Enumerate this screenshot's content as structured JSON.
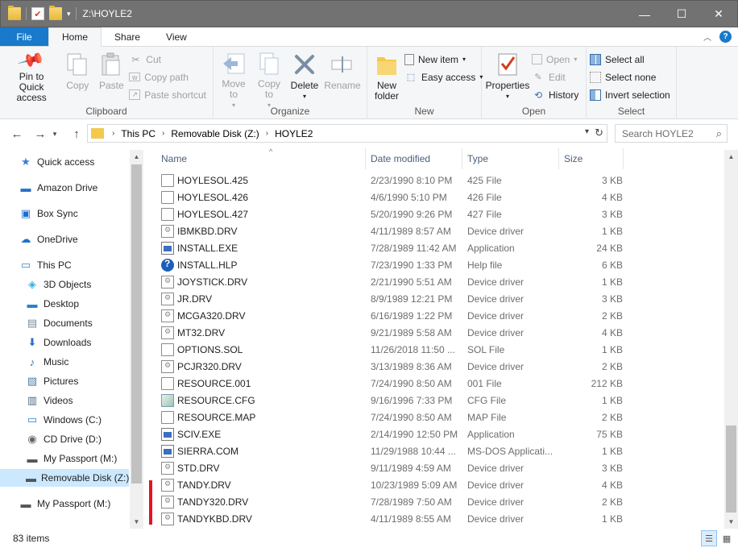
{
  "window": {
    "title": "Z:\\HOYLE2"
  },
  "ribbon_tabs": [
    "File",
    "Home",
    "Share",
    "View"
  ],
  "ribbon": {
    "clipboard": {
      "label": "Clipboard",
      "pin": "Pin to Quick access",
      "copy": "Copy",
      "paste": "Paste",
      "cut": "Cut",
      "copy_path": "Copy path",
      "paste_shortcut": "Paste shortcut"
    },
    "organize": {
      "label": "Organize",
      "move_to": "Move to",
      "copy_to": "Copy to",
      "delete": "Delete",
      "rename": "Rename"
    },
    "new": {
      "label": "New",
      "new_folder": "New folder",
      "new_item": "New item",
      "easy_access": "Easy access"
    },
    "open": {
      "label": "Open",
      "properties": "Properties",
      "open": "Open",
      "edit": "Edit",
      "history": "History"
    },
    "select": {
      "label": "Select",
      "select_all": "Select all",
      "select_none": "Select none",
      "invert": "Invert selection"
    }
  },
  "address": {
    "crumbs": [
      "This PC",
      "Removable Disk (Z:)",
      "HOYLE2"
    ],
    "search_placeholder": "Search HOYLE2"
  },
  "nav": [
    {
      "label": "Quick access",
      "icon": "star-icon"
    },
    {
      "label": "Amazon Drive",
      "icon": "amazon-drive-icon"
    },
    {
      "label": "Box Sync",
      "icon": "box-icon"
    },
    {
      "label": "OneDrive",
      "icon": "cloud-icon"
    },
    {
      "label": "This PC",
      "icon": "computer-icon"
    },
    {
      "label": "3D Objects",
      "icon": "cube-icon"
    },
    {
      "label": "Desktop",
      "icon": "desktop-icon"
    },
    {
      "label": "Documents",
      "icon": "documents-icon"
    },
    {
      "label": "Downloads",
      "icon": "download-arrow-icon"
    },
    {
      "label": "Music",
      "icon": "music-note-icon"
    },
    {
      "label": "Pictures",
      "icon": "pictures-icon"
    },
    {
      "label": "Videos",
      "icon": "film-icon"
    },
    {
      "label": "Windows (C:)",
      "icon": "windows-drive-icon"
    },
    {
      "label": "CD Drive (D:)",
      "icon": "cd-drive-icon"
    },
    {
      "label": "My Passport (M:)",
      "icon": "usb-drive-icon"
    },
    {
      "label": "Removable Disk (Z:)",
      "icon": "usb-drive-icon"
    },
    {
      "label": "My Passport (M:)",
      "icon": "usb-drive-icon"
    }
  ],
  "columns": {
    "name": "Name",
    "date": "Date modified",
    "type": "Type",
    "size": "Size"
  },
  "files": [
    {
      "name": "HOYLESOL.425",
      "date": "2/23/1990 8:10 PM",
      "type": "425 File",
      "size": "3 KB",
      "icon": "doc"
    },
    {
      "name": "HOYLESOL.426",
      "date": "4/6/1990 5:10 PM",
      "type": "426 File",
      "size": "4 KB",
      "icon": "doc"
    },
    {
      "name": "HOYLESOL.427",
      "date": "5/20/1990 9:26 PM",
      "type": "427 File",
      "size": "3 KB",
      "icon": "doc"
    },
    {
      "name": "IBMKBD.DRV",
      "date": "4/11/1989 8:57 AM",
      "type": "Device driver",
      "size": "1 KB",
      "icon": "gear"
    },
    {
      "name": "INSTALL.EXE",
      "date": "7/28/1989 11:42 AM",
      "type": "Application",
      "size": "24 KB",
      "icon": "app"
    },
    {
      "name": "INSTALL.HLP",
      "date": "7/23/1990 1:33 PM",
      "type": "Help file",
      "size": "6 KB",
      "icon": "help"
    },
    {
      "name": "JOYSTICK.DRV",
      "date": "2/21/1990 5:51 AM",
      "type": "Device driver",
      "size": "1 KB",
      "icon": "gear"
    },
    {
      "name": "JR.DRV",
      "date": "8/9/1989 12:21 PM",
      "type": "Device driver",
      "size": "3 KB",
      "icon": "gear"
    },
    {
      "name": "MCGA320.DRV",
      "date": "6/16/1989 1:22 PM",
      "type": "Device driver",
      "size": "2 KB",
      "icon": "gear"
    },
    {
      "name": "MT32.DRV",
      "date": "9/21/1989 5:58 AM",
      "type": "Device driver",
      "size": "4 KB",
      "icon": "gear"
    },
    {
      "name": "OPTIONS.SOL",
      "date": "11/26/2018 11:50 ...",
      "type": "SOL File",
      "size": "1 KB",
      "icon": "doc"
    },
    {
      "name": "PCJR320.DRV",
      "date": "3/13/1989 8:36 AM",
      "type": "Device driver",
      "size": "2 KB",
      "icon": "gear"
    },
    {
      "name": "RESOURCE.001",
      "date": "7/24/1990 8:50 AM",
      "type": "001 File",
      "size": "212 KB",
      "icon": "doc"
    },
    {
      "name": "RESOURCE.CFG",
      "date": "9/16/1996 7:33 PM",
      "type": "CFG File",
      "size": "1 KB",
      "icon": "cfg"
    },
    {
      "name": "RESOURCE.MAP",
      "date": "7/24/1990 8:50 AM",
      "type": "MAP File",
      "size": "2 KB",
      "icon": "doc"
    },
    {
      "name": "SCIV.EXE",
      "date": "2/14/1990 12:50 PM",
      "type": "Application",
      "size": "75 KB",
      "icon": "app"
    },
    {
      "name": "SIERRA.COM",
      "date": "11/29/1988 10:44 ...",
      "type": "MS-DOS Applicati...",
      "size": "1 KB",
      "icon": "app"
    },
    {
      "name": "STD.DRV",
      "date": "9/11/1989 4:59 AM",
      "type": "Device driver",
      "size": "3 KB",
      "icon": "gear"
    },
    {
      "name": "TANDY.DRV",
      "date": "10/23/1989 5:09 AM",
      "type": "Device driver",
      "size": "4 KB",
      "icon": "gear"
    },
    {
      "name": "TANDY320.DRV",
      "date": "7/28/1989 7:50 AM",
      "type": "Device driver",
      "size": "2 KB",
      "icon": "gear"
    },
    {
      "name": "TANDYKBD.DRV",
      "date": "4/11/1989 8:55 AM",
      "type": "Device driver",
      "size": "1 KB",
      "icon": "gear"
    }
  ],
  "status": {
    "count": "83 items"
  },
  "colors": {
    "accent": "#1979ca",
    "selected": "#cce8ff",
    "titlebar": "#727272",
    "marker": "#e81123"
  }
}
